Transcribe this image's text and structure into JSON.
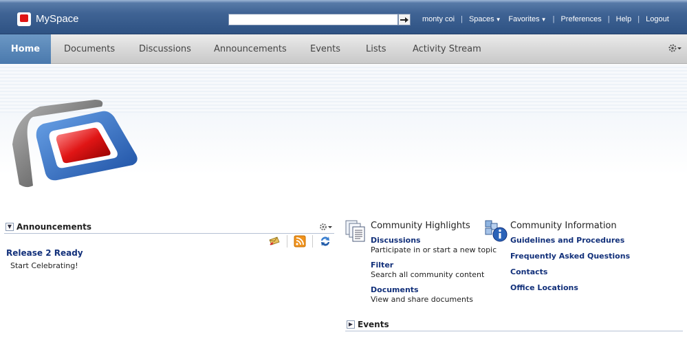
{
  "app": {
    "brand": "MySpace"
  },
  "search": {
    "value": "",
    "placeholder": ""
  },
  "toplinks": {
    "user": "monty coi",
    "spaces": "Spaces",
    "favorites": "Favorites",
    "preferences": "Preferences",
    "help": "Help",
    "logout": "Logout"
  },
  "nav": {
    "tabs": [
      {
        "label": "Home",
        "active": true
      },
      {
        "label": "Documents"
      },
      {
        "label": "Discussions"
      },
      {
        "label": "Announcements"
      },
      {
        "label": "Events"
      },
      {
        "label": "Lists"
      },
      {
        "label": "Activity Stream"
      }
    ]
  },
  "announcements": {
    "title": "Announcements",
    "item_title": "Release 2 Ready",
    "item_body": "Start Celebrating!"
  },
  "highlights": {
    "title": "Community Highlights",
    "items": [
      {
        "title": "Discussions",
        "desc": "Participate in or start a new topic"
      },
      {
        "title": "Filter",
        "desc": "Search all community content"
      },
      {
        "title": "Documents",
        "desc": "View and share documents"
      }
    ]
  },
  "info": {
    "title": "Community Information",
    "links": [
      "Guidelines and Procedures",
      "Frequently Asked Questions",
      "Contacts",
      "Office Locations"
    ]
  },
  "events": {
    "title": "Events"
  },
  "colors": {
    "topbar": "#3f6394",
    "link": "#12307a",
    "active_tab": "#5a88b9",
    "logo_red": "#e01515",
    "logo_blue": "#2b63b8"
  }
}
